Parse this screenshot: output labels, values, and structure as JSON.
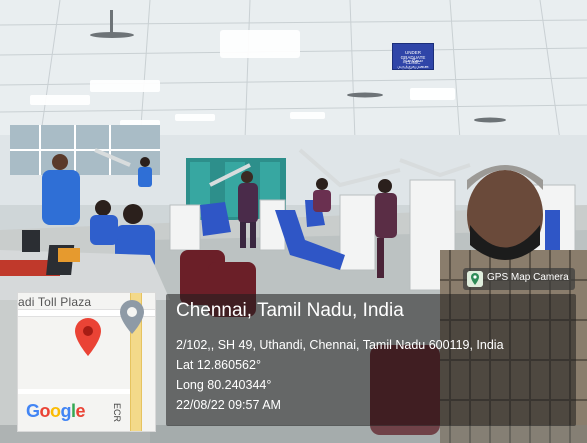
{
  "gps_badge": {
    "label": "GPS Map Camera",
    "icon": "gps-map-camera-icon"
  },
  "location": {
    "title": "Chennai, Tamil Nadu, India",
    "address": "2/102,, SH 49, Uthandi, Chennai, Tamil Nadu 600119, India",
    "lat": "Lat 12.860562°",
    "long": "Long 80.240344°",
    "datetime": "22/08/22 09:57 AM"
  },
  "map": {
    "road_label": "adi Toll Plaza",
    "road_name": "ECR",
    "brand": [
      "G",
      "o",
      "o",
      "g",
      "l",
      "e"
    ],
    "pin_color": "#EA4335"
  },
  "sign": {
    "line1": "UNDER GRADUATE CLINIC",
    "line2": "இளநிலை மருத்துவமனை"
  }
}
